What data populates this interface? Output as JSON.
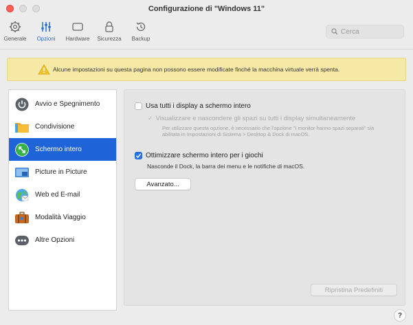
{
  "window": {
    "title": "Configurazione di \"Windows 11\""
  },
  "toolbar": {
    "items": [
      {
        "label": "Generale",
        "icon": "gear-icon"
      },
      {
        "label": "Opzioni",
        "icon": "sliders-icon",
        "active": true
      },
      {
        "label": "Hardware",
        "icon": "display-icon"
      },
      {
        "label": "Sicurezza",
        "icon": "lock-icon"
      },
      {
        "label": "Backup",
        "icon": "history-icon"
      }
    ],
    "search_placeholder": "Cerca"
  },
  "warning": {
    "text": "Alcune impostazioni su questa pagina non possono essere modificate finché la macchina virtuale verrà spenta.",
    "icon": "warning-triangle-icon"
  },
  "sidebar": {
    "items": [
      {
        "label": "Avvio e Spegnimento",
        "icon": "power-icon"
      },
      {
        "label": "Condivisione",
        "icon": "folder-icon"
      },
      {
        "label": "Schermo intero",
        "icon": "fullscreen-icon",
        "selected": true
      },
      {
        "label": "Picture in Picture",
        "icon": "picture-in-picture-icon"
      },
      {
        "label": "Web ed E-mail",
        "icon": "globe-icon"
      },
      {
        "label": "Modalità Viaggio",
        "icon": "suitcase-icon"
      },
      {
        "label": "Altre Opzioni",
        "icon": "more-icon"
      }
    ]
  },
  "panel": {
    "option1": {
      "label": "Usa tutti i display a schermo intero",
      "checked": false
    },
    "option1_sub": {
      "label": "Visualizzare e nascondere gli spazi su tutti i display simultaneamente",
      "checked": true,
      "disabled": true
    },
    "option1_desc": "Per utilizzare questa opzione, è necessario che l'opzione \"I monitor hanno spazi separati\" sia abilitata in Impostazioni di Sistema > Desktop & Dock di macOS.",
    "option2": {
      "label": "Ottimizzare schermo intero per i giochi",
      "checked": true
    },
    "option2_desc": "Nasconde il Dock, la barra dei menu e le notifiche di macOS.",
    "advanced_button": "Avanzato...",
    "restore_button": "Ripristina Predefiniti"
  },
  "help_label": "?",
  "colors": {
    "accent": "#1f63d8",
    "warning_bg": "#f6e9a6",
    "close": "#ff5f57"
  }
}
